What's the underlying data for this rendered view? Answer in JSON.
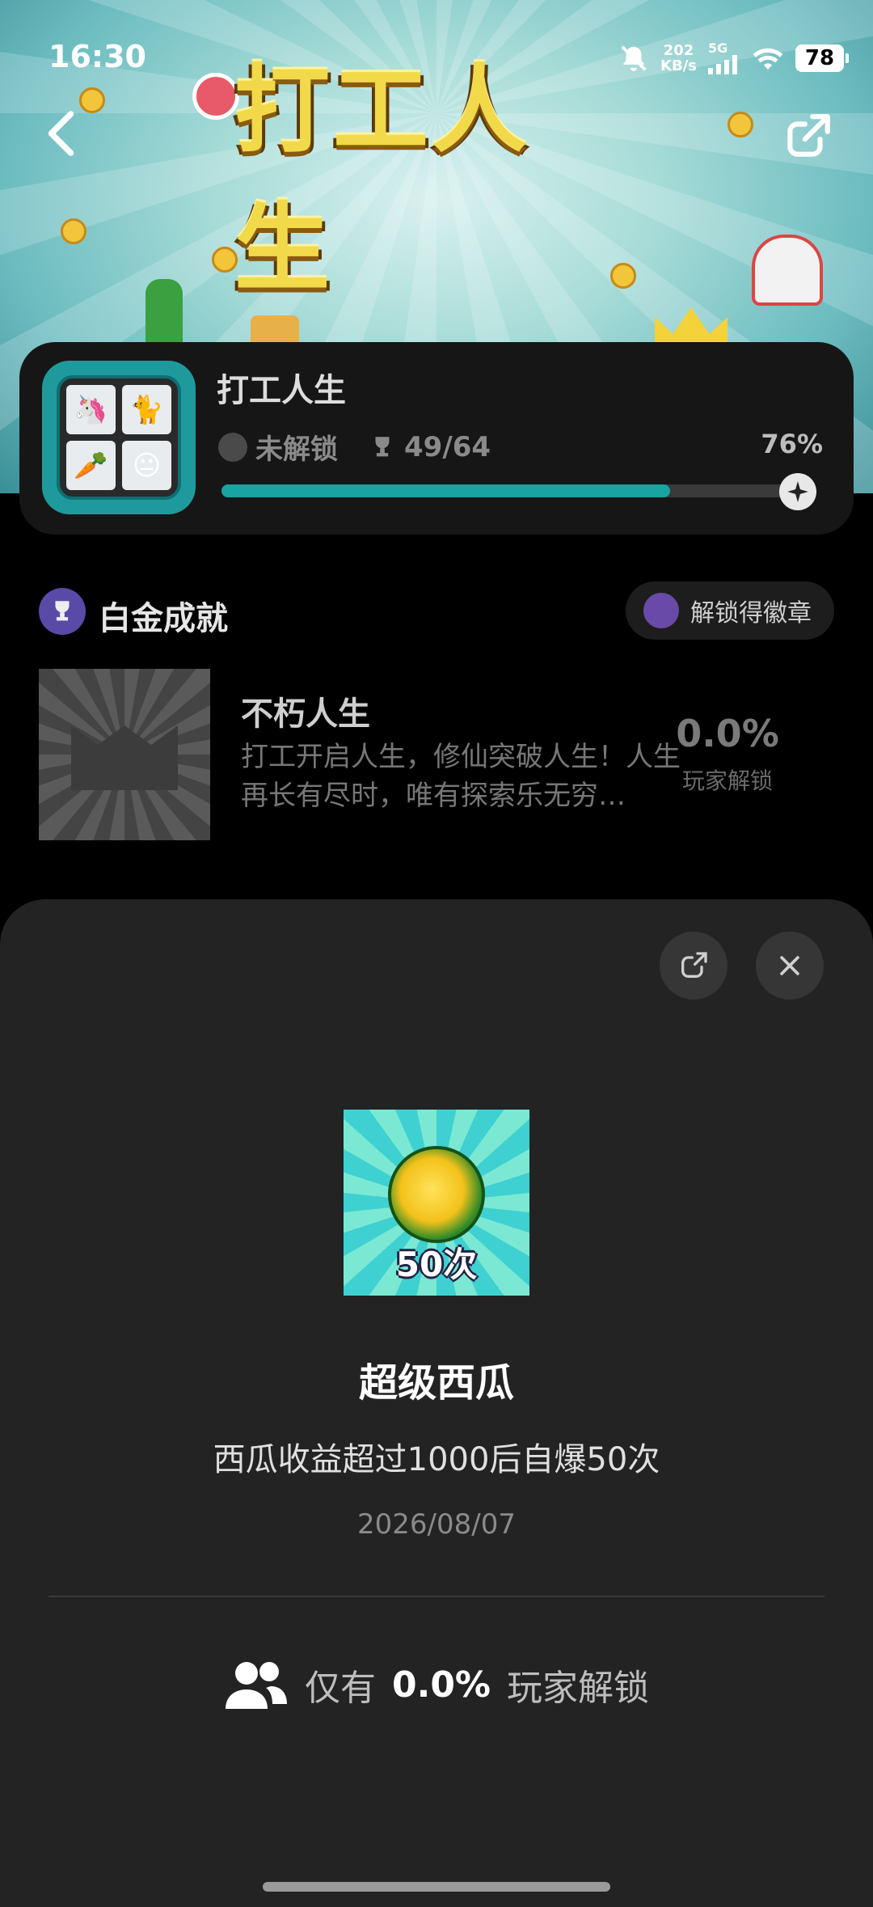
{
  "status_bar": {
    "time": "16:30",
    "net_speed_value": "202",
    "net_speed_unit": "KB/s",
    "network": "5G",
    "battery": "78"
  },
  "hero": {
    "title": "打工人生"
  },
  "game": {
    "name": "打工人生",
    "platinum_status": "未解锁",
    "trophy_count": "49/64",
    "progress_percent": "76%",
    "progress_value": 0.76
  },
  "platinum": {
    "label": "白金成就",
    "badge_button": "解锁得徽章"
  },
  "achievement_item": {
    "title": "不朽人生",
    "description": "打工开启人生，修仙突破人生！人生再长有尽时，唯有探索乐无穷…",
    "percent": "0.0%",
    "percent_label": "玩家解锁"
  },
  "sheet": {
    "image_label": "50次",
    "title": "超级西瓜",
    "description": "西瓜收益超过1000后自爆50次",
    "date": "2026/08/07",
    "unlock_prefix": "仅有",
    "unlock_percent": "0.0%",
    "unlock_suffix": "玩家解锁"
  },
  "colors": {
    "accent": "#19a3a1",
    "sheet_bg": "#232323",
    "card_bg": "#161616"
  },
  "icons": [
    "back-icon",
    "share-icon",
    "trophy-icon",
    "platinum-icon",
    "badge-icon",
    "refresh-share-icon",
    "close-icon",
    "users-icon",
    "star-icon"
  ]
}
